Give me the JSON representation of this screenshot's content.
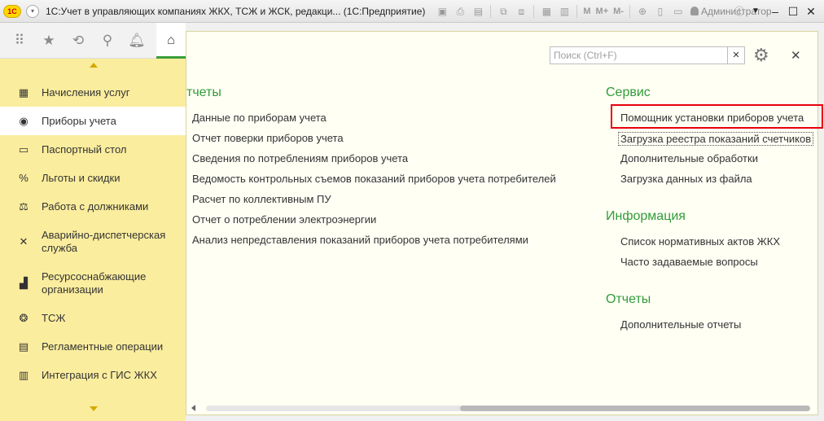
{
  "window": {
    "logo_text": "1С",
    "title": "1С:Учет в управляющих компаниях ЖКХ, ТСЖ и ЖСК, редакци... (1С:Предприятие)",
    "toolbar_text": [
      "M",
      "M+",
      "M-"
    ],
    "user": "Администратор"
  },
  "sections": [
    {
      "icon": "calculator-icon",
      "glyph": "▦",
      "label": "Начисления услуг"
    },
    {
      "icon": "meter-icon",
      "glyph": "◉",
      "label": "Приборы учета",
      "active": true
    },
    {
      "icon": "passport-icon",
      "glyph": "▭",
      "label": "Паспортный стол"
    },
    {
      "icon": "percent-icon",
      "glyph": "%",
      "label": "Льготы и скидки"
    },
    {
      "icon": "gavel-icon",
      "glyph": "⚖",
      "label": "Работа с должниками"
    },
    {
      "icon": "tools-icon",
      "glyph": "✕",
      "label": "Аварийно-диспетчерская служба"
    },
    {
      "icon": "resource-icon",
      "glyph": "▟",
      "label": "Ресурсоснабжающие организации"
    },
    {
      "icon": "people-icon",
      "glyph": "❂",
      "label": "ТСЖ"
    },
    {
      "icon": "operations-icon",
      "glyph": "▤",
      "label": "Регламентные операции"
    },
    {
      "icon": "building-icon",
      "glyph": "▥",
      "label": "Интеграция с ГИС ЖКХ"
    }
  ],
  "search": {
    "placeholder": "Поиск (Ctrl+F)"
  },
  "reports": {
    "title": "тчеты",
    "items": [
      "Данные по приборам учета",
      "Отчет поверки приборов учета",
      "Сведения по потреблениям приборов учета",
      "Ведомость контрольных съемов показаний приборов учета потребителей",
      "Расчет по коллективным ПУ",
      "Отчет о потреблении электроэнергии",
      "Анализ непредставления показаний приборов учета потребителями"
    ]
  },
  "service": {
    "title": "Сервис",
    "items": [
      "Помощник установки приборов учета",
      "Загрузка реестра показаний счетчиков",
      "Дополнительные обработки",
      "Загрузка данных из файла"
    ]
  },
  "info": {
    "title": "Информация",
    "items": [
      "Список нормативных актов ЖКХ",
      "Часто задаваемые вопросы"
    ]
  },
  "extra_reports": {
    "title": "Отчеты",
    "items": [
      "Дополнительные отчеты"
    ]
  },
  "colors": {
    "accent_green": "#319b3a",
    "section_bg": "#fbed9e",
    "highlight_red": "#e8000b"
  }
}
